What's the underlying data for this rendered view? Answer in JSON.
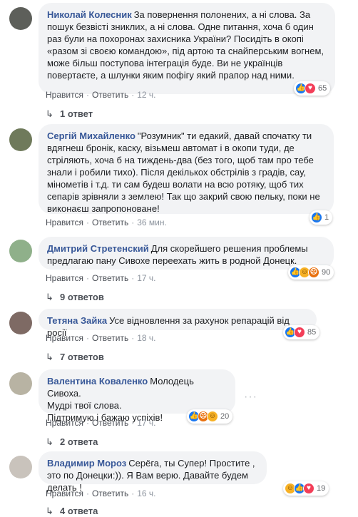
{
  "comments": [
    {
      "author": "Николай Колесник",
      "text": "За повернення полонених, а ні слова. За пошук безвісті зниклих, а ні слова. Одне питання, хоча б один раз були на похоронах захисника України? Посидіть в окопі «разом зі своєю командою», під артою та снайперським вогнем, може більш поступова інтеграція буде. Ви не українців повертаєте, а шлунки яким пофігу який прапор над ними.",
      "reactions_count": "65",
      "reaction_icons": [
        "like",
        "love"
      ],
      "like_label": "Нравится",
      "reply_label": "Ответить",
      "time": "12 ч.",
      "replies_label": "1 ответ"
    },
    {
      "author": "Сергій Михайленко",
      "text": "\"Розумник\" ти едакий, давай спочатку ти вдягнеш бронік, каску, візьмеш автомат і в окопи туди, де стріляють, хоча б на тиждень-два (без того, щоб там про тебе знали і робили тихо). Після декількох обстрілів з градів, сау, мінометів і т.д. ти сам будеш волати на всю ротяку, щоб тих сепарів зрівняли з землею! Так що закрий свою пельку, поки не виконаєш запропоноване!",
      "reactions_count": "1",
      "reaction_icons": [
        "like"
      ],
      "like_label": "Нравится",
      "reply_label": "Ответить",
      "time": "36 мин."
    },
    {
      "author": "Дмитрий Стретенский",
      "text": "Для скорейшего решения проблемы предлагаю пану Сивохе переехать жить в родной Донецк.",
      "reactions_count": "90",
      "reaction_icons": [
        "like",
        "haha",
        "angry"
      ],
      "like_label": "Нравится",
      "reply_label": "Ответить",
      "time": "17 ч.",
      "replies_label": "9 ответов"
    },
    {
      "author": "Тетяна Зайка",
      "text": "Усе відновлення за рахунок репарацій від росії",
      "reactions_count": "85",
      "reaction_icons": [
        "like",
        "love"
      ],
      "like_label": "Нравится",
      "reply_label": "Ответить",
      "time": "18 ч.",
      "replies_label": "7 ответов"
    },
    {
      "author": "Валентина Коваленко",
      "text": "Молодець Сивоха.\nМудрі твої слова.\nПідтримую і бажаю успіхів!",
      "reactions_count": "20",
      "reaction_icons": [
        "like",
        "angry",
        "haha"
      ],
      "like_label": "Нравится",
      "reply_label": "Ответить",
      "time": "17 ч.",
      "replies_label": "2 ответа"
    },
    {
      "author": "Владимир Мороз",
      "text": "Серёга, ты Супер! Простите , это по Донецки:)). Я Вам верю. Давайте будем делать !",
      "reactions_count": "19",
      "reaction_icons": [
        "haha",
        "like",
        "love"
      ],
      "like_label": "Нравится",
      "reply_label": "Ответить",
      "time": "16 ч.",
      "replies_label": "4 ответа"
    }
  ],
  "colors": {
    "author": "#385898",
    "bubble": "#f2f3f5",
    "like": "#1877f2",
    "love": "#f33e58"
  }
}
